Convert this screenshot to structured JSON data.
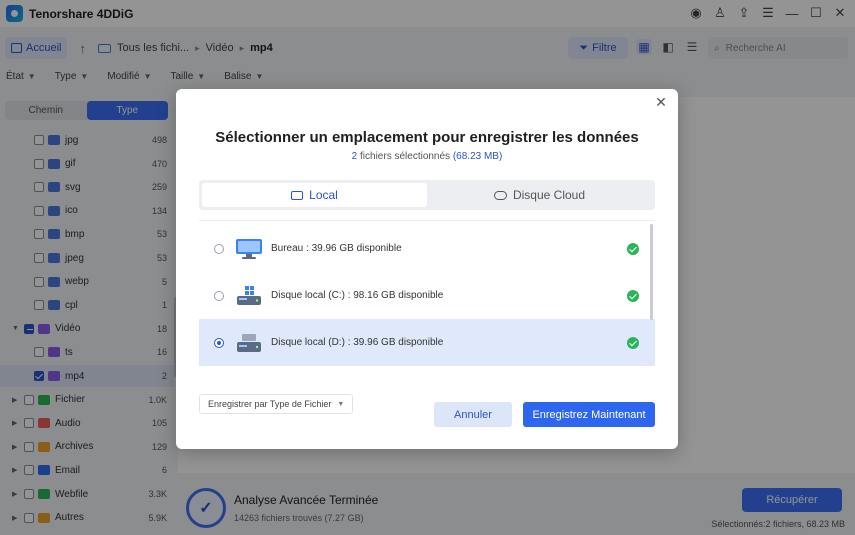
{
  "app": {
    "title": "Tenorshare 4DDiG"
  },
  "nav": {
    "home": "Accueil",
    "crumbs": [
      "Tous les fichi...",
      "Vidéo",
      "mp4"
    ],
    "filter": "Filtre",
    "search_placeholder": "Recherche AI"
  },
  "filters": [
    "État",
    "Type",
    "Modifié",
    "Taille",
    "Balise"
  ],
  "sidebar": {
    "seg_path": "Chemin",
    "seg_type": "Type",
    "rows": [
      {
        "label": "jpg",
        "count": "498",
        "color": "#4b78e0"
      },
      {
        "label": "gif",
        "count": "470",
        "color": "#4b78e0"
      },
      {
        "label": "svg",
        "count": "259",
        "color": "#4b78e0"
      },
      {
        "label": "ico",
        "count": "134",
        "color": "#4b78e0"
      },
      {
        "label": "bmp",
        "count": "53",
        "color": "#4b78e0"
      },
      {
        "label": "jpeg",
        "count": "53",
        "color": "#4b78e0"
      },
      {
        "label": "webp",
        "count": "5",
        "color": "#4b78e0"
      },
      {
        "label": "cpl",
        "count": "1",
        "color": "#4b78e0"
      },
      {
        "label": "Vidéo",
        "count": "18",
        "color": "#8a5cf0"
      },
      {
        "label": "ts",
        "count": "16",
        "color": "#8a5cf0"
      },
      {
        "label": "mp4",
        "count": "2",
        "color": "#8a5cf0"
      },
      {
        "label": "Fichier",
        "count": "1.0K",
        "color": "#2bb55a"
      },
      {
        "label": "Audio",
        "count": "105",
        "color": "#f05a5a"
      },
      {
        "label": "Archives",
        "count": "129",
        "color": "#f0a028"
      },
      {
        "label": "Email",
        "count": "6",
        "color": "#2a6df4"
      },
      {
        "label": "Webfile",
        "count": "3.3K",
        "color": "#2bb55a"
      },
      {
        "label": "Autres",
        "count": "5.9K",
        "color": "#f0a028"
      }
    ]
  },
  "status": {
    "title": "Analyse Avancée Terminée",
    "sub": "14263 fichiers trouvés (7.27 GB)",
    "recover": "Récupérer",
    "selected": "Sélectionnés:2 fichiers, 68.23 MB"
  },
  "modal": {
    "title": "Sélectionner un emplacement pour enregistrer les données",
    "sub_count": "2",
    "sub_text": "fichiers sélectionnés",
    "sub_size": "(68.23 MB)",
    "tab_local": "Local",
    "tab_cloud": "Disque Cloud",
    "locations": [
      {
        "label": "Bureau  : 39.96 GB disponible",
        "selected": false
      },
      {
        "label": "Disque local (C:) : 98.16 GB disponible",
        "selected": false
      },
      {
        "label": "Disque local (D:) : 39.96 GB disponible",
        "selected": true
      }
    ],
    "save_by_type": "Enregistrer par Type de Fichier",
    "cancel": "Annuler",
    "save_now": "Enregistrez Maintenant"
  }
}
